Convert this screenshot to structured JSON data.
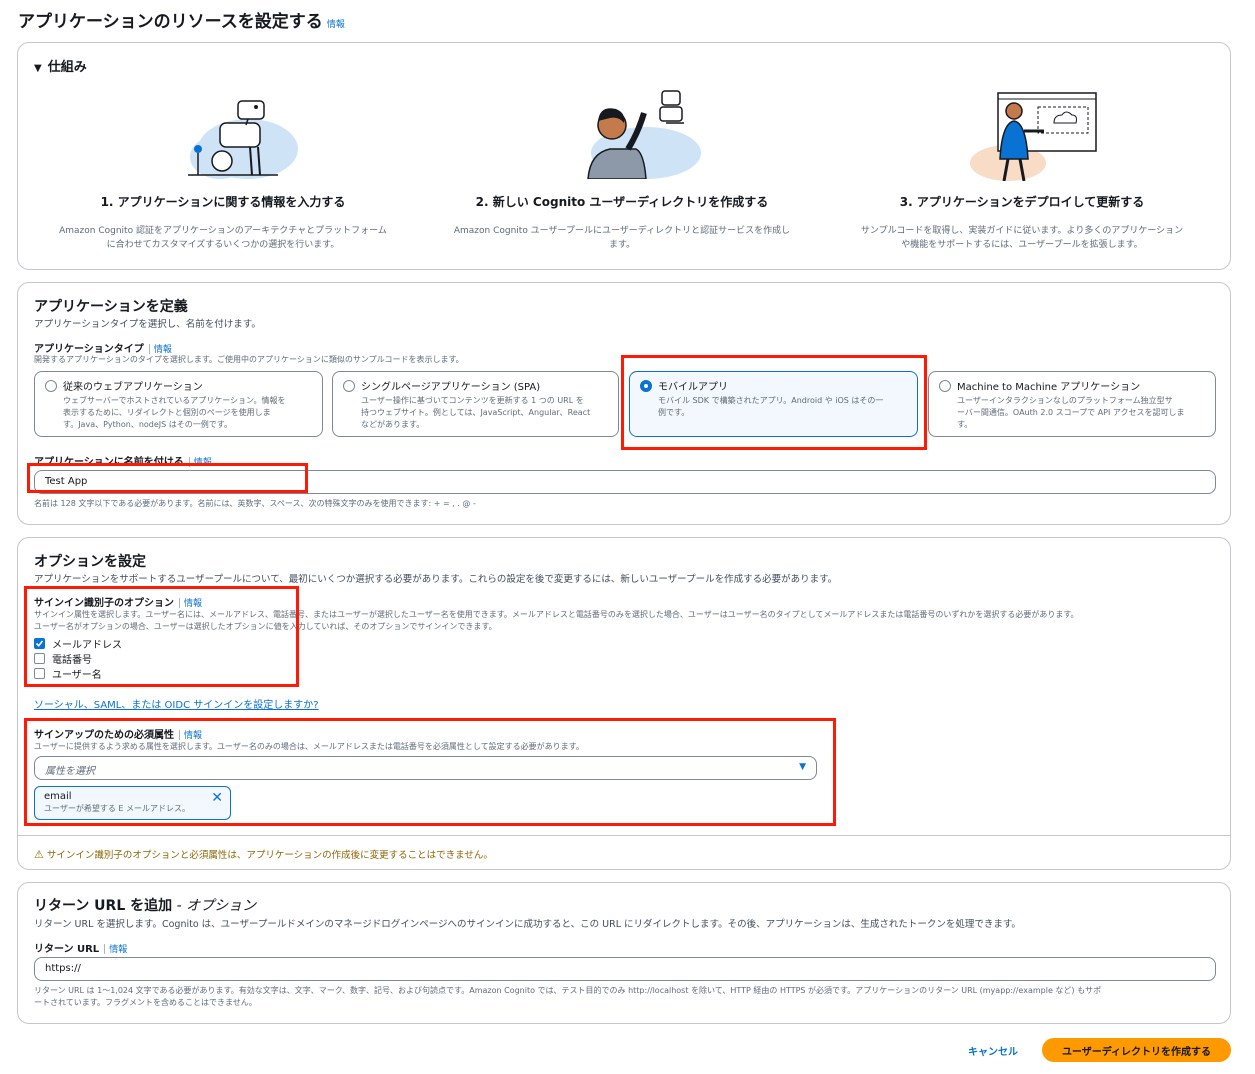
{
  "page": {
    "title": "アプリケーションのリソースを設定する",
    "info": "情報"
  },
  "how": {
    "title": "仕組み",
    "steps": [
      {
        "title": "1. アプリケーションに関する情報を入力する",
        "desc1": "Amazon Cognito 認証をアプリケーションのアーキテクチャとプラットフォーム",
        "desc2": "に合わせてカスタマイズするいくつかの選択を行います。"
      },
      {
        "title": "2. 新しい Cognito ユーザーディレクトリを作成する",
        "desc1": "Amazon Cognito ユーザープールにユーザーディレクトリと認証サービスを作成し",
        "desc2": "ます。"
      },
      {
        "title": "3. アプリケーションをデプロイして更新する",
        "desc1": "サンプルコードを取得し、実装ガイドに従います。より多くのアプリケーション",
        "desc2": "や機能をサポートするには、ユーザープールを拡張します。"
      }
    ]
  },
  "define": {
    "title": "アプリケーションを定義",
    "desc": "アプリケーションタイプを選択し、名前を付けます。",
    "type_label": "アプリケーションタイプ",
    "type_info": "情報",
    "type_desc": "開発するアプリケーションのタイプを選択します。ご使用中のアプリケーションに類似のサンプルコードを表示します。",
    "types": [
      {
        "title": "従来のウェブアプリケーション",
        "d1": "ウェブサーバーでホストされているアプリケーション。情報を",
        "d2": "表示するために、リダイレクトと個別のページを使用しま",
        "d3": "す。Java、Python、nodeJS はその一例です。"
      },
      {
        "title": "シングルページアプリケーション (SPA)",
        "d1": "ユーザー操作に基づいてコンテンツを更新する 1 つの URL を",
        "d2": "持つウェブサイト。例としては、JavaScript、Angular、React",
        "d3": "などがあります。"
      },
      {
        "title": "モバイルアプリ",
        "d1": "モバイル SDK で構築されたアプリ。Android や iOS はその一",
        "d2": "例です。",
        "d3": ""
      },
      {
        "title": "Machine to Machine アプリケーション",
        "d1": "ユーザーインタラクションなしのプラットフォーム独立型サ",
        "d2": "ーバー間通信。OAuth 2.0 スコープで API アクセスを認可しま",
        "d3": "す。"
      }
    ],
    "selected_type": "モバイルアプリ",
    "name_label": "アプリケーションに名前を付ける",
    "name_info": "情報",
    "name_value": "Test App",
    "name_hint": "名前は 128 文字以下である必要があります。名前には、英数字、スペース、次の特殊文字のみを使用できます: + = , . @ -"
  },
  "options": {
    "title": "オプションを設定",
    "desc": "アプリケーションをサポートするユーザープールについて、最初にいくつか選択する必要があります。これらの設定を後で変更するには、新しいユーザープールを作成する必要があります。",
    "signin_label": "サインイン識別子のオプション",
    "signin_info": "情報",
    "signin_desc1": "サインイン属性を選択します。ユーザー名には、メールアドレス、電話番号、またはユーザーが選択したユーザー名を使用できます。メールアドレスと電話番号のみを選択した場合、ユーザーはユーザー名のタイプとしてメールアドレスまたは電話番号のいずれかを選択する必要があります。",
    "signin_desc2": "ユーザー名がオプションの場合、ユーザーは選択したオプションに値を入力していれば、そのオプションでサインインできます。",
    "checkboxes": [
      {
        "label": "メールアドレス",
        "checked": true
      },
      {
        "label": "電話番号",
        "checked": false
      },
      {
        "label": "ユーザー名",
        "checked": false
      }
    ],
    "social_link": "ソーシャル、SAML、または OIDC サインインを設定しますか?",
    "required_label": "サインアップのための必須属性",
    "required_info": "情報",
    "required_desc": "ユーザーに提供するよう求める属性を選択します。ユーザー名のみの場合は、メールアドレスまたは電話番号を必須属性として設定する必要があります。",
    "select_placeholder": "属性を選択",
    "token": {
      "name": "email",
      "desc": "ユーザーが希望する E メールアドレス。"
    },
    "warning": "サインイン識別子のオプションと必須属性は、アプリケーションの作成後に変更することはできません。"
  },
  "return_url": {
    "title": "リターン URL を追加",
    "title_suffix": " - オプション",
    "desc": "リターン URL を選択します。Cognito は、ユーザープールドメインのマネージドログインページへのサインインに成功すると、この URL にリダイレクトします。その後、アプリケーションは、生成されたトークンを処理できます。",
    "label": "リターン URL",
    "info": "情報",
    "value": "https://",
    "hint1": "リターン URL は 1〜1,024 文字である必要があります。有効な文字は、文字、マーク、数字、記号、および句読点です。Amazon Cognito では、テスト目的でのみ http://localhost を除いて、HTTP 経由の HTTPS が必須です。アプリケーションのリターン URL (myapp://example など) もサポ",
    "hint2": "ートされています。フラグメントを含めることはできません。"
  },
  "footer": {
    "cancel": "キャンセル",
    "create": "ユーザーディレクトリを作成する"
  },
  "colors": {
    "primary": "#0972d3",
    "create_button": "#ff9900",
    "highlight": "#ff1a06",
    "warning": "#8d6605"
  }
}
